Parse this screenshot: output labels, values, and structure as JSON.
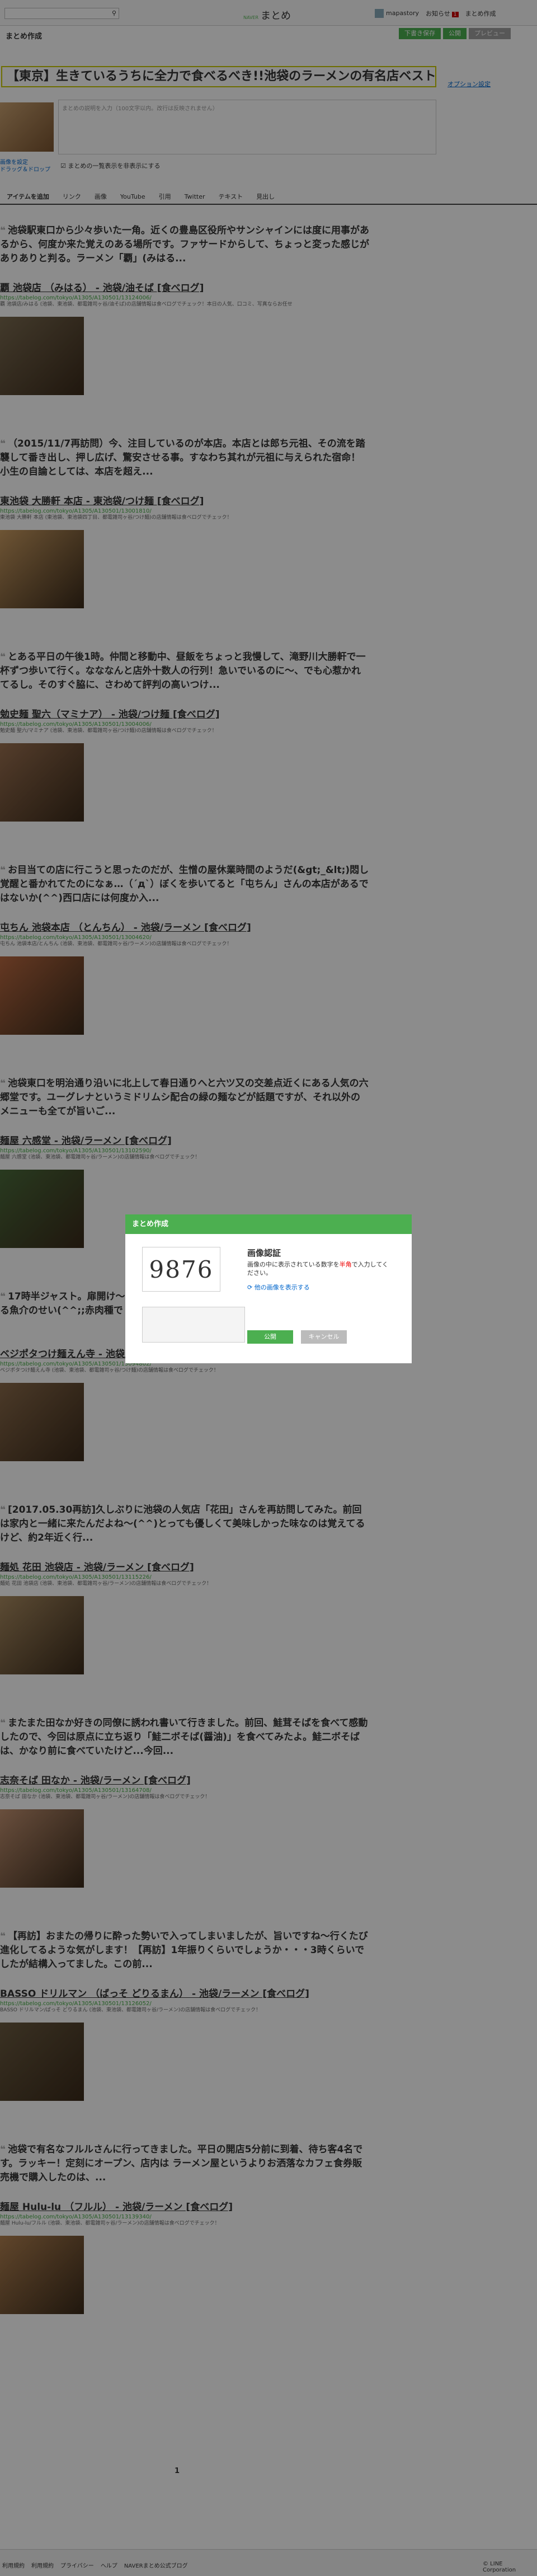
{
  "header": {
    "search_placeholder": "",
    "logo_small": "NAVER",
    "logo_text": "まとめ",
    "user_name": "mapastory",
    "notice_label": "お知らせ",
    "notice_count": "1",
    "create_label": "まとめ作成"
  },
  "titlebar": {
    "page_label": "まとめ作成",
    "draft_button": "下書き保存",
    "publish_button": "公開",
    "preview_button": "プレビュー"
  },
  "headline": "【東京】生きているうちに全力で食べるべき!!池袋のラーメンの有名店ベスト10",
  "option_link": "オプション設定",
  "description_placeholder": "まとめの説明を入力（100文字以内。改行は反映されません）",
  "thumbnail_note": [
    "画像を設定",
    "ドラッグ＆ドロップ"
  ],
  "hide_option_label": "まとめの一覧表示を非表示にする",
  "tabs": [
    "アイテムを追加",
    "リンク",
    "画像",
    "YouTube",
    "引用",
    "Twitter",
    "テキスト",
    "見出し"
  ],
  "items": [
    {
      "quote": "池袋駅東口から少々歩いた一角。近くの豊島区役所やサンシャインには度に用事があるから、何度か来た覚えのある場所です。ファサードからして、ちょっと変った感じがありありと判る。ラーメン「覇」(みはる...",
      "title": "覇 池袋店 （みはる） - 池袋/油そば [食べログ]",
      "url": "https://tabelog.com/tokyo/A1305/A130501/13124006/",
      "snippet": "覇 池袋店/みはる (池袋、東池袋、都電雑司ヶ谷/油そば)の店舗情報は食べログでチェック！本日の人気、口コミ、写真ならお任せ",
      "thumb": "#7a6a50"
    },
    {
      "quote": "（2015/11/7再訪問）今、注目しているのが本店。本店とは郎ち元祖、その流を踏襲して番き出し、押し広げ、驚安させる事。すなわち其れが元祖に与えられた宿命！小生の自論としては、本店を超え...",
      "title": "東池袋 大勝軒 本店 - 東池袋/つけ麺 [食べログ]",
      "url": "https://tabelog.com/tokyo/A1305/A130501/13001810/",
      "snippet": "東池袋 大勝軒 本店 (東池袋、東池袋四丁目、都電雑司ヶ谷/つけ麺)の店舗情報は食べログでチェック！",
      "thumb": "#c89a60"
    },
    {
      "quote": "とある平日の午後1時。仲間と移動中、昼飯をちょっと我慢して、滝野川大勝軒で一杯ずつ歩いて行く。なななんと店外十数人の行列！急いでいるのに〜、でも心惹かれてるし。そのすぐ脇に、さわめて評判の高いつけ...",
      "title": "勉史麺 聖六（マミナア） - 池袋/つけ麺 [食べログ]",
      "url": "https://tabelog.com/tokyo/A1305/A130501/13004006/",
      "snippet": "勉史麺 聖六/マミナア (池袋、東池袋、都電雑司ヶ谷/つけ麺)の店舗情報は食べログでチェック！",
      "thumb": "#9a7050"
    },
    {
      "quote": "お目当ての店に行こうと思ったのだが、生憎の屋休業時間のようだ(&gt;_&lt;)悶し覚醒と番かれてたのになぁ…（´д`）ぼくを歩いてると「屯ちん」さんの本店があるではないか(^^)西口店には何度か入...",
      "title": "屯ちん 池袋本店 （とんちん） - 池袋/ラーメン [食べログ]",
      "url": "https://tabelog.com/tokyo/A1305/A130501/13004620/",
      "snippet": "屯ちん 池袋本店/とんちん (池袋、東池袋、都電雑司ヶ谷/ラーメン)の店舗情報は食べログでチェック！",
      "thumb": "#b86840"
    },
    {
      "quote": "池袋東口を明治通り沿いに北上して春日通りへと六ツ又の交差点近くにある人気の六郷堂です。ユーグレナというミドリムシ配合の緑の麺などが話題ですが、それ以外のメニューも全てが旨いご...",
      "title": "麺屋 六感堂 - 池袋/ラーメン [食べログ]",
      "url": "https://tabelog.com/tokyo/A1305/A130501/13102590/",
      "snippet": "麺屋 六感堂 (池袋、東池袋、都電雑司ヶ谷/ラーメン)の店舗情報は食べログでチェック！",
      "thumb": "#4a6a3a"
    },
    {
      "quote": "17時半ジャスト。扉開け〜と言われて一番乗りで。店内はとても清潔で奥まで貫ける魚介のせい(^^;;赤肉種で「ベジポタつけ麺(800)大盛り無料」...",
      "title": "ベジポタつけ麺えん寺 - 池袋/つけ麺 [食べログ]",
      "url": "https://tabelog.com/tokyo/A1305/A130501/13094802/",
      "snippet": "ベジポタつけ麺えん寺 (池袋、東池袋、都電雑司ヶ谷/つけ麺)の店舗情報は食べログでチェック！",
      "thumb": "#8a6a4a"
    },
    {
      "quote": "[2017.05.30再訪]久しぶりに池袋の人気店「花田」さんを再訪問してみた。前回は家内と一緒に来たんだよね〜(^^)とっても優しくて美味しかった味なのは覚えてるけど、約2年近く行...",
      "title": "麺処 花田 池袋店 - 池袋/ラーメン [食べログ]",
      "url": "https://tabelog.com/tokyo/A1305/A130501/13115226/",
      "snippet": "麺処 花田 池袋店 (池袋、東池袋、都電雑司ヶ谷/ラーメン)の店舗情報は食べログでチェック！",
      "thumb": "#a88a60"
    },
    {
      "quote": "またまた田なか好きの同僚に誘われ書いて行きました。前回、鮭茸そばを食べて感動したので、今回は原点に立ち返り「鮭二ボそば(醤油)」を食べてみたよ。鮭二ボそばは、かなり前に食べていたけど...今回...",
      "title": "志奈そば 田なか - 池袋/ラーメン [食べログ]",
      "url": "https://tabelog.com/tokyo/A1305/A130501/13164708/",
      "snippet": "志奈そば 田なか (池袋、東池袋、都電雑司ヶ谷/ラーメン)の店舗情報は食べログでチェック！",
      "thumb": "#c09070"
    },
    {
      "quote": "【再訪】おまたの帰りに酔った勢いで入ってしまいましたが、旨いですね〜行くたび進化してるような気がします！【再訪】1年振りくらいでしょうか・・・3時くらいでしたが結構入ってました。この前...",
      "title": "BASSO ドリルマン （ばっそ どりるまん） - 池袋/ラーメン [食べログ]",
      "url": "https://tabelog.com/tokyo/A1305/A130501/13126052/",
      "snippet": "BASSO ドリルマン/ばっそ どりるまん (池袋、東池袋、都電雑司ヶ谷/ラーメン)の店舗情報は食べログでチェック！",
      "thumb": "#6a5a40"
    },
    {
      "quote": "池袋で有名なフルルさんに行ってきました。平日の開店5分前に到着、待ち客4名です。ラッキー！定刻にオープン、店内は ラーメン屋というよりお洒落なカフェ食券販売機で購入したのは、...",
      "title": "麺屋 Hulu-lu （フルル） - 池袋/ラーメン [食べログ]",
      "url": "https://tabelog.com/tokyo/A1305/A130501/13139340/",
      "snippet": "麺屋 Hulu-lu/フルル (池袋、東池袋、都電雑司ヶ谷/ラーメン)の店舗情報は食べログでチェック！",
      "thumb": "#b08050"
    }
  ],
  "pager": "1",
  "footer": {
    "links": [
      "利用規約",
      "利用規約",
      "プライバシー",
      "ヘルプ",
      "NAVERまとめ公式ブログ"
    ],
    "copyright": "© LINE Corporation"
  },
  "modal": {
    "header": "まとめ作成",
    "captcha_code": "9876",
    "title": "画像認証",
    "desc_before": "画像の中に表示されている数字を",
    "desc_red": "半角",
    "desc_after": "で入力してください。",
    "reload": "他の画像を表示する",
    "submit": "公開",
    "cancel": "キャンセル"
  }
}
